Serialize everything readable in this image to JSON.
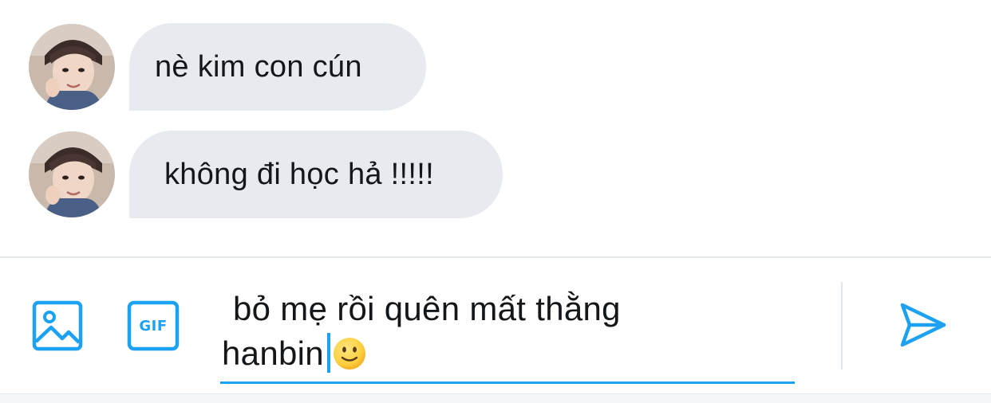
{
  "conversation": {
    "messages": [
      {
        "text": "nè kim con cún",
        "sender": "received"
      },
      {
        "text": "không đi học hả !!!!!",
        "sender": "received"
      }
    ]
  },
  "composer": {
    "text_line1": "bỏ mẹ rồi quên mất thằng",
    "text_line2": "hanbin",
    "trailing_emoji": "slightly-smiling-face-emoji",
    "media_button_icon": "image-icon",
    "gif_button_label": "GIF",
    "send_button_icon": "send-icon"
  },
  "colors": {
    "accent": "#1da1f2",
    "bubble_background": "#e7ebf0",
    "text": "#14171a",
    "divider": "#e1e6ea"
  }
}
